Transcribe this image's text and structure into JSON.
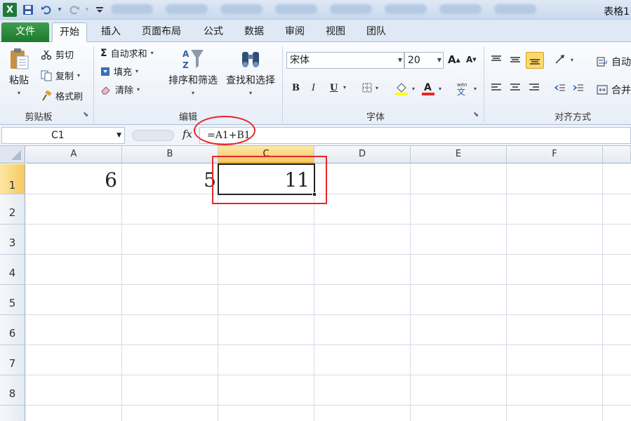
{
  "titlebar": {
    "app_icon": "X",
    "doc_title": "表格1",
    "icons": [
      "excel-logo-icon",
      "save-icon",
      "undo-icon",
      "redo-icon",
      "customize-icon"
    ]
  },
  "tabs": [
    {
      "label": "文件"
    },
    {
      "label": "开始"
    },
    {
      "label": "插入"
    },
    {
      "label": "页面布局"
    },
    {
      "label": "公式"
    },
    {
      "label": "数据"
    },
    {
      "label": "审阅"
    },
    {
      "label": "视图"
    },
    {
      "label": "团队"
    }
  ],
  "clipboard": {
    "paste": "粘贴",
    "cut": "剪切",
    "copy": "复制",
    "format_painter": "格式刷",
    "group_label": "剪贴板"
  },
  "editing": {
    "autosum": "自动求和",
    "fill": "填充",
    "clear": "清除",
    "sort_filter": "排序和筛选",
    "find_select": "查找和选择",
    "group_label": "编辑"
  },
  "font": {
    "name": "宋体",
    "size": "20",
    "bold": "B",
    "italic": "I",
    "underline": "U",
    "group_label": "字体",
    "fill_color": "#ffff00",
    "font_color": "#e8262a"
  },
  "alignment": {
    "autowrap": "自动",
    "merge": "合并",
    "group_label": "对齐方式"
  },
  "formula_bar": {
    "name_box": "C1",
    "fx": "fx",
    "formula": "=A1+B1"
  },
  "sheet": {
    "columns": [
      "A",
      "B",
      "C",
      "D",
      "E",
      "F"
    ],
    "rows": [
      "1",
      "2",
      "3",
      "4",
      "5",
      "6",
      "7",
      "8"
    ],
    "selected_column": "C",
    "selected_row": "1",
    "cells": {
      "A1": "6",
      "B1": "5",
      "C1": "11"
    }
  },
  "annotation_color": "#e8262a"
}
